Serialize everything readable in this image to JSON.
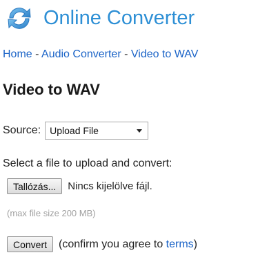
{
  "brand": {
    "name": "Online Converter",
    "color": "#2d8fd5",
    "icon": "refresh-arrows-icon"
  },
  "breadcrumb": {
    "items": [
      "Home",
      "Audio Converter",
      "Video to WAV"
    ],
    "separator": "-"
  },
  "page": {
    "title": "Video to WAV"
  },
  "source": {
    "label": "Source:",
    "selected": "Upload File"
  },
  "upload": {
    "prompt": "Select a file to upload and convert:",
    "browse_label": "Tallózás...",
    "no_file_text": "Nincs kijelölve fájl.",
    "hint": "(max file size 200 MB)"
  },
  "convert": {
    "button_label": "Convert",
    "note_prefix": "(confirm you agree to ",
    "terms_link": "terms",
    "note_suffix": ")"
  },
  "colors": {
    "link": "#1a63c7",
    "hint": "#a0a0a0"
  }
}
